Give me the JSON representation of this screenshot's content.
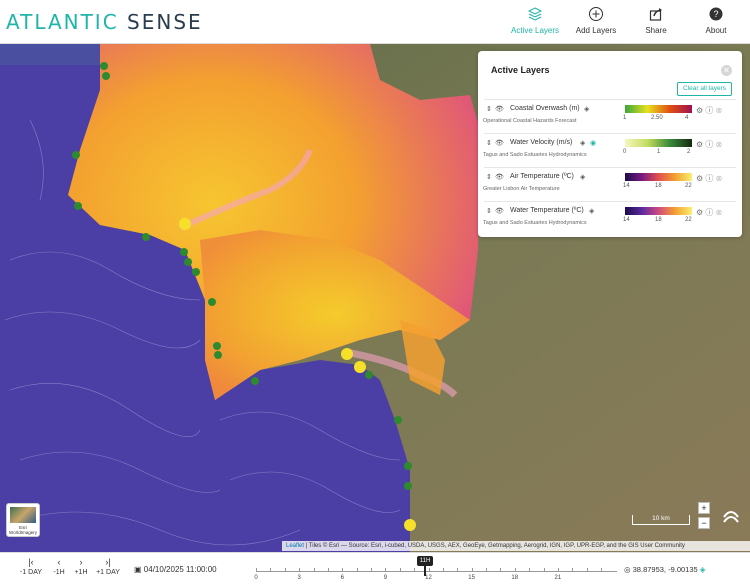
{
  "header": {
    "logo_part1": "ATLANTIC",
    "logo_part2": "SENSE",
    "nav": [
      {
        "label": "Active Layers",
        "icon": "layers-icon",
        "active": true
      },
      {
        "label": "Add Layers",
        "icon": "add-circle-icon",
        "active": false
      },
      {
        "label": "Share",
        "icon": "share-icon",
        "active": false
      },
      {
        "label": "About",
        "icon": "help-circle-icon",
        "active": false
      }
    ]
  },
  "panel": {
    "title": "Active Layers",
    "clear_label": "Clear all layers",
    "layers": [
      {
        "name": "Coastal Overwash (m)",
        "subtitle": "Operational Coastal Hazards Forecast",
        "ticks": [
          "1",
          "2.50",
          "4"
        ]
      },
      {
        "name": "Water Velocity (m/s)",
        "subtitle": "Tagus and Sado Estuaries Hydrodynamics",
        "ticks": [
          "0",
          "1",
          "2"
        ]
      },
      {
        "name": "Air Temperature (ºC)",
        "subtitle": "Greater Lisbon Air Temperature",
        "ticks": [
          "14",
          "18",
          "22"
        ]
      },
      {
        "name": "Water Temperature (ºC)",
        "subtitle": "Tagus and Sado Estuaries Hydrodynamics",
        "ticks": [
          "14",
          "18",
          "22"
        ]
      }
    ]
  },
  "map": {
    "zoom_in": "+",
    "zoom_out": "−",
    "scale_label": "10 km",
    "basemap_label": "Esri WorldImagery",
    "attribution_link": "Leaflet",
    "attribution_text": "| Tiles © Esri — Source: Esri, i-cubed, USDA, USGS, AEX, GeoEye, Getmapping, Aerogrid, IGN, IGP, UPR-EGP, and the GIS User Community"
  },
  "footer": {
    "buttons": [
      {
        "icon": "|‹",
        "label": "-1 DAY"
      },
      {
        "icon": "‹",
        "label": "-1H"
      },
      {
        "icon": "›",
        "label": "+1H"
      },
      {
        "icon": "›|",
        "label": "+1 DAY"
      }
    ],
    "date": "04/10/2025 11:00:00",
    "timeline_labels": [
      "0",
      "3",
      "6",
      "9",
      "12",
      "15",
      "18",
      "21"
    ],
    "timeline_current": "11H",
    "coords": "38.87953, -9.00135"
  },
  "colors": {
    "accent": "#1fb5a8",
    "ocean": "#4a3fa8",
    "land_hot": "#f29a2e",
    "land_warm": "#f3c22f"
  }
}
